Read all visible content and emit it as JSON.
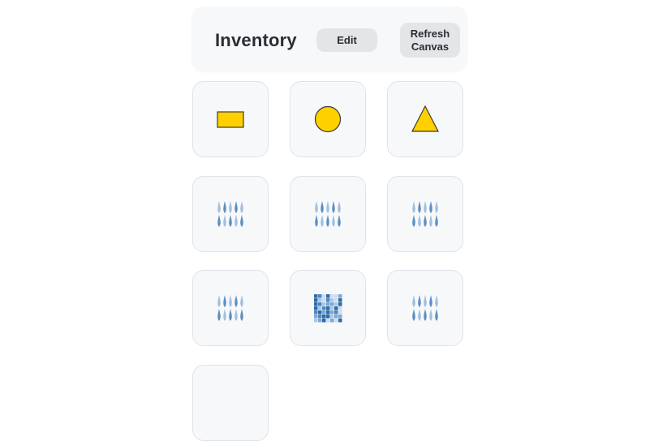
{
  "inventory": {
    "title": "Inventory",
    "edit_label": "Edit",
    "refresh_label": "Refresh\nCanvas"
  },
  "items": [
    {
      "icon": "rectangle-icon",
      "color": "#ffd000"
    },
    {
      "icon": "circle-icon",
      "color": "#ffd000"
    },
    {
      "icon": "triangle-icon",
      "color": "#ffd000"
    },
    {
      "icon": "raindrops-icon",
      "color": "#5b8fc2"
    },
    {
      "icon": "raindrops-icon",
      "color": "#5b8fc2"
    },
    {
      "icon": "raindrops-icon",
      "color": "#5b8fc2"
    },
    {
      "icon": "raindrops-icon",
      "color": "#5b8fc2"
    },
    {
      "icon": "mosaic-pattern-icon",
      "color": "#5b8fc2"
    },
    {
      "icon": "raindrops-icon",
      "color": "#5b8fc2"
    },
    {
      "icon": "empty-slot",
      "color": "#f7f8fa"
    }
  ]
}
